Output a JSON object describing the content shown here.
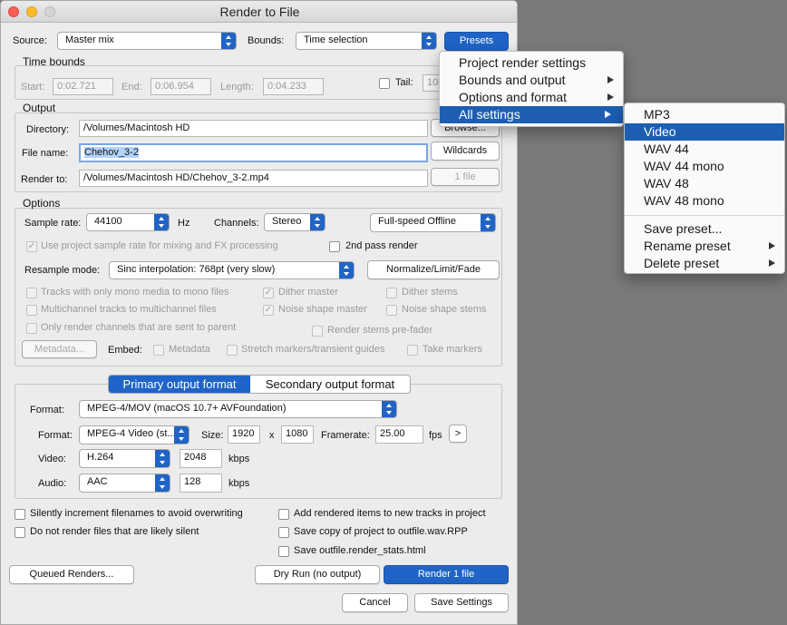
{
  "window": {
    "title": "Render to File"
  },
  "source": {
    "label": "Source:",
    "value": "Master mix"
  },
  "bounds": {
    "label": "Bounds:",
    "value": "Time selection"
  },
  "presets_label": "Presets",
  "time_bounds": {
    "title": "Time bounds",
    "start_label": "Start:",
    "start": "0:02.721",
    "end_label": "End:",
    "end": "0:06.954",
    "length_label": "Length:",
    "length": "0:04.233",
    "tail_label": "Tail:",
    "tail": "100"
  },
  "output": {
    "title": "Output",
    "directory_label": "Directory:",
    "directory": "/Volumes/Macintosh HD",
    "browse_label": "Browse...",
    "filename_label": "File name:",
    "filename": "Chehov_3-2",
    "wildcards_label": "Wildcards",
    "render_to_label": "Render to:",
    "render_to": "/Volumes/Macintosh HD/Chehov_3-2.mp4",
    "files_label": "1 file"
  },
  "options": {
    "title": "Options",
    "sample_rate_label": "Sample rate:",
    "sample_rate": "44100",
    "hz": "Hz",
    "channels_label": "Channels:",
    "channels": "Stereo",
    "speed": "Full-speed Offline",
    "use_project_rate": "Use project sample rate for mixing and FX processing",
    "two_pass": "2nd pass render",
    "resample_label": "Resample mode:",
    "resample": "Sinc interpolation: 768pt (very slow)",
    "normalize": "Normalize/Limit/Fade",
    "mono_tracks": "Tracks with only mono media to mono files",
    "dither_master": "Dither master",
    "dither_stems": "Dither stems",
    "multichannel": "Multichannel tracks to multichannel files",
    "noise_master": "Noise shape master",
    "noise_stems": "Noise shape stems",
    "only_parent": "Only render channels that are sent to parent",
    "stems_prefader": "Render stems pre-fader",
    "metadata_btn": "Metadata...",
    "embed_label": "Embed:",
    "embed_metadata": "Metadata",
    "embed_stretch": "Stretch markers/transient guides",
    "embed_take": "Take markers"
  },
  "format": {
    "tab_primary": "Primary output format",
    "tab_secondary": "Secondary output format",
    "format_label": "Format:",
    "format": "MPEG-4/MOV (macOS 10.7+ AVFoundation)",
    "subformat_label": "Format:",
    "subformat": "MPEG-4 Video (st...",
    "size_label": "Size:",
    "width": "1920",
    "x": "x",
    "height": "1080",
    "framerate_label": "Framerate:",
    "framerate": "25.00",
    "fps": "fps",
    "more": ">",
    "video_label": "Video:",
    "video_codec": "H.264",
    "video_kbps": "2048",
    "kbps1": "kbps",
    "audio_label": "Audio:",
    "audio_codec": "AAC",
    "audio_kbps": "128",
    "kbps2": "kbps"
  },
  "bottom": {
    "silently_increment": "Silently increment filenames to avoid overwriting",
    "add_rendered": "Add rendered items to new tracks in project",
    "no_silent": "Do not render files that are likely silent",
    "save_copy": "Save copy of project to outfile.wav.RPP",
    "save_stats": "Save outfile.render_stats.html",
    "queued": "Queued Renders...",
    "dry_run": "Dry Run (no output)",
    "render": "Render 1 file",
    "cancel": "Cancel",
    "save_settings": "Save Settings"
  },
  "presets_menu": {
    "items": [
      "Project render settings",
      "Bounds and output",
      "Options and format",
      "All settings"
    ]
  },
  "submenu": {
    "items": [
      "MP3",
      "Video",
      "WAV 44",
      "WAV 44 mono",
      "WAV 48",
      "WAV 48 mono"
    ],
    "actions": [
      "Save preset...",
      "Rename preset",
      "Delete preset"
    ]
  },
  "colors": {
    "accent": "#1f64c6",
    "highlight": "#1d5eb3",
    "window": "#ececec"
  }
}
